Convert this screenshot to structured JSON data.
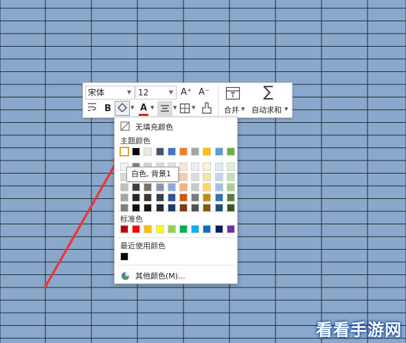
{
  "colors": {
    "sheet_fill": "#8aa8cc",
    "grid_line": "#1f2a36",
    "arrow": "#e33b3b",
    "selected_swatch_border": "#e8a23a",
    "font_color_underline": "#e02020",
    "watermark_glow": "#1a4f9c"
  },
  "toolbar": {
    "font_name": "宋体",
    "font_size": "12",
    "grow_font": "A⁺",
    "shrink_font": "A⁻",
    "bold_label": "B",
    "font_color_letter": "A",
    "merge_label": "合并",
    "autosum_label": "自动求和",
    "icons": [
      "font-grow-icon",
      "font-shrink-icon",
      "wrap-text-icon",
      "fill-color-icon",
      "font-color-icon",
      "align-center-icon",
      "border-icon",
      "format-painter-icon",
      "merge-cells-icon",
      "autosum-icon"
    ]
  },
  "color_menu": {
    "no_fill": "无填充颜色",
    "theme_title": "主题颜色",
    "standard_title": "标准色",
    "recent_title": "最近使用颜色",
    "more_colors": "其他颜色(M)...",
    "tooltip": "白色, 背景1",
    "theme_top": [
      "#ffffff",
      "#000000",
      "#e7e6e6",
      "#44546a",
      "#4472c4",
      "#ed7d31",
      "#a5a5a5",
      "#ffc000",
      "#5b9bd5",
      "#70ad47"
    ],
    "theme_shades": [
      [
        "#f2f2f2",
        "#7f7f7f",
        "#d0cece",
        "#d6dce4",
        "#d9e2f3",
        "#fbe5d5",
        "#ededed",
        "#fff2cc",
        "#deebf6",
        "#e2efd9"
      ],
      [
        "#d8d8d8",
        "#595959",
        "#aeabab",
        "#adb9ca",
        "#b4c6e7",
        "#f7cbac",
        "#dbdbdb",
        "#fee599",
        "#bdd7ee",
        "#c5e0b3"
      ],
      [
        "#bfbfbf",
        "#3f3f3f",
        "#757070",
        "#8496b0",
        "#8eaadb",
        "#f4b183",
        "#c9c9c9",
        "#ffd965",
        "#9dc3e6",
        "#a8d08d"
      ],
      [
        "#a5a5a5",
        "#262626",
        "#3a3838",
        "#323f4f",
        "#2f5496",
        "#c55a11",
        "#7b7b7b",
        "#bf8f00",
        "#2e75b5",
        "#538135"
      ],
      [
        "#7f7f7f",
        "#0d0d0d",
        "#171616",
        "#222a35",
        "#1f3864",
        "#833c0b",
        "#525252",
        "#7f6000",
        "#1e4e79",
        "#375623"
      ]
    ],
    "standard": [
      "#c00000",
      "#ff0000",
      "#ffc000",
      "#ffff00",
      "#92d050",
      "#00b050",
      "#00b0f0",
      "#0070c0",
      "#002060",
      "#7030a0"
    ],
    "recent": [
      "#000000"
    ]
  },
  "watermark": "看看手游网"
}
